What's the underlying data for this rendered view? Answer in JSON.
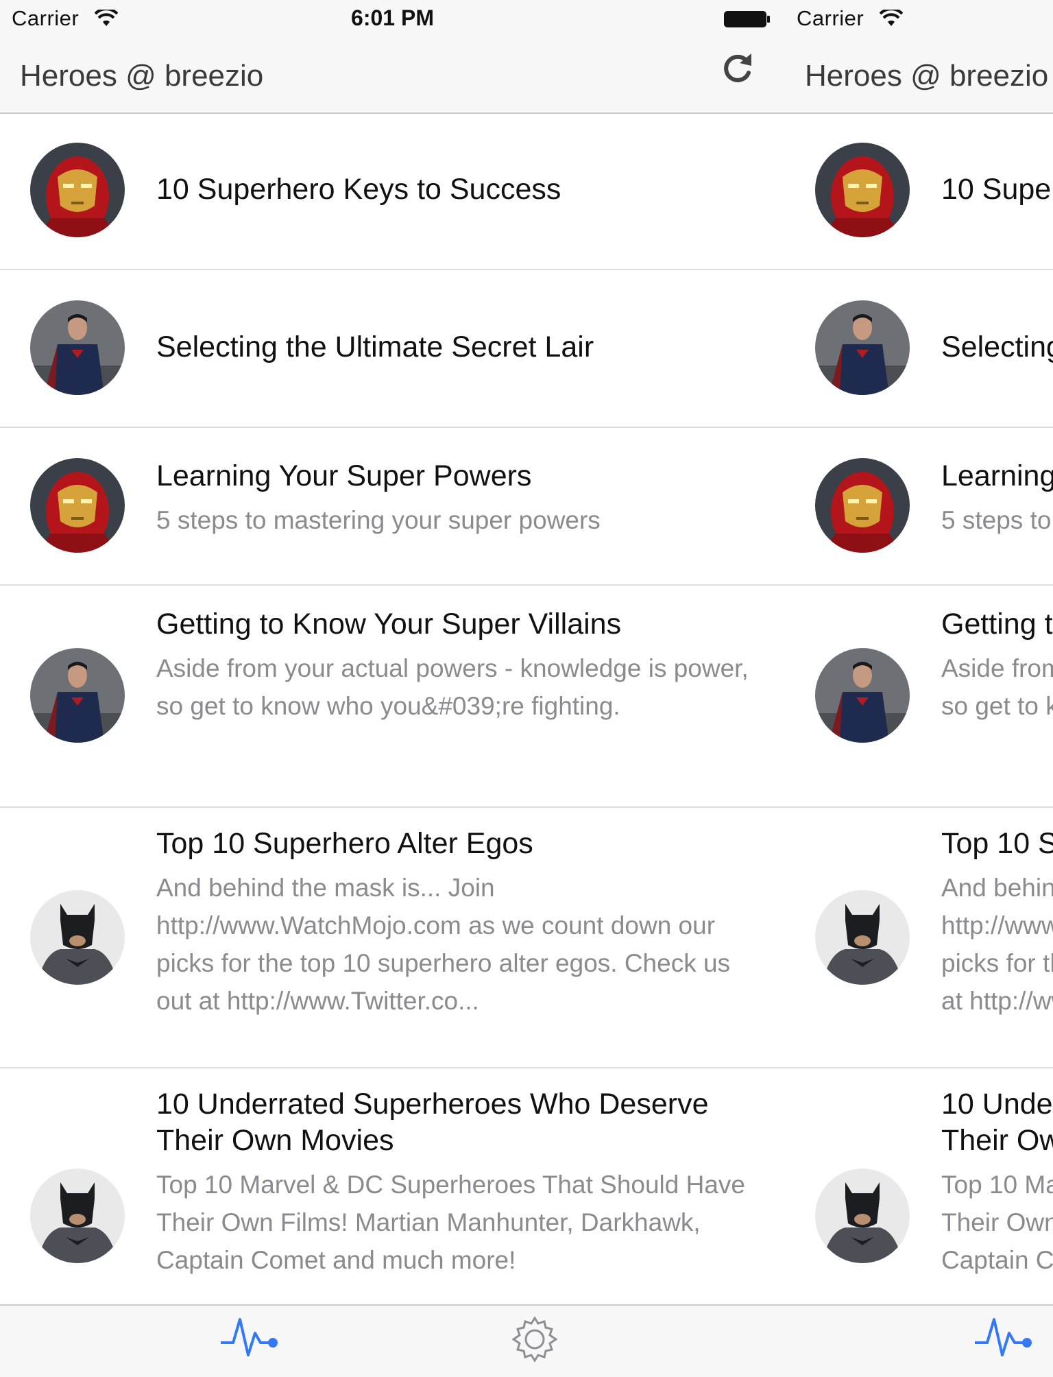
{
  "status_bar": {
    "carrier": "Carrier",
    "time": "6:01 PM"
  },
  "nav": {
    "title": "Heroes @ breezio",
    "refresh_icon": "refresh-icon"
  },
  "rows": [
    {
      "avatar": "ironman",
      "title": "10 Superhero Keys to Success",
      "subtitle": ""
    },
    {
      "avatar": "superman",
      "title": "Selecting the Ultimate Secret Lair",
      "subtitle": ""
    },
    {
      "avatar": "ironman",
      "title": "Learning Your Super Powers",
      "subtitle": "5 steps to mastering your super powers"
    },
    {
      "avatar": "superman",
      "title": "Getting to Know Your Super Villains",
      "subtitle": "Aside from your actual powers - knowledge is power, so get to know who you&#039;re fighting."
    },
    {
      "avatar": "batman",
      "title": "Top 10 Superhero Alter Egos",
      "subtitle": "And behind the mask is... Join http://www.WatchMojo.com as we count down our picks for the top 10 superhero alter egos. Check us out at http://www.Twitter.co..."
    },
    {
      "avatar": "batman",
      "title": "10 Underrated Superheroes Who Deserve Their Own Movies",
      "subtitle": "Top 10 Marvel & DC Superheroes That Should Have Their Own Films! Martian Manhunter, Darkhawk, Captain Comet and much more!"
    }
  ],
  "tabs": [
    {
      "icon": "pulse-icon",
      "active": true
    },
    {
      "icon": "gear-icon",
      "active": false
    }
  ],
  "colors": {
    "accent": "#3478f6",
    "subtitle": "#8a8a8f",
    "bar_bg": "#f7f7f7"
  }
}
